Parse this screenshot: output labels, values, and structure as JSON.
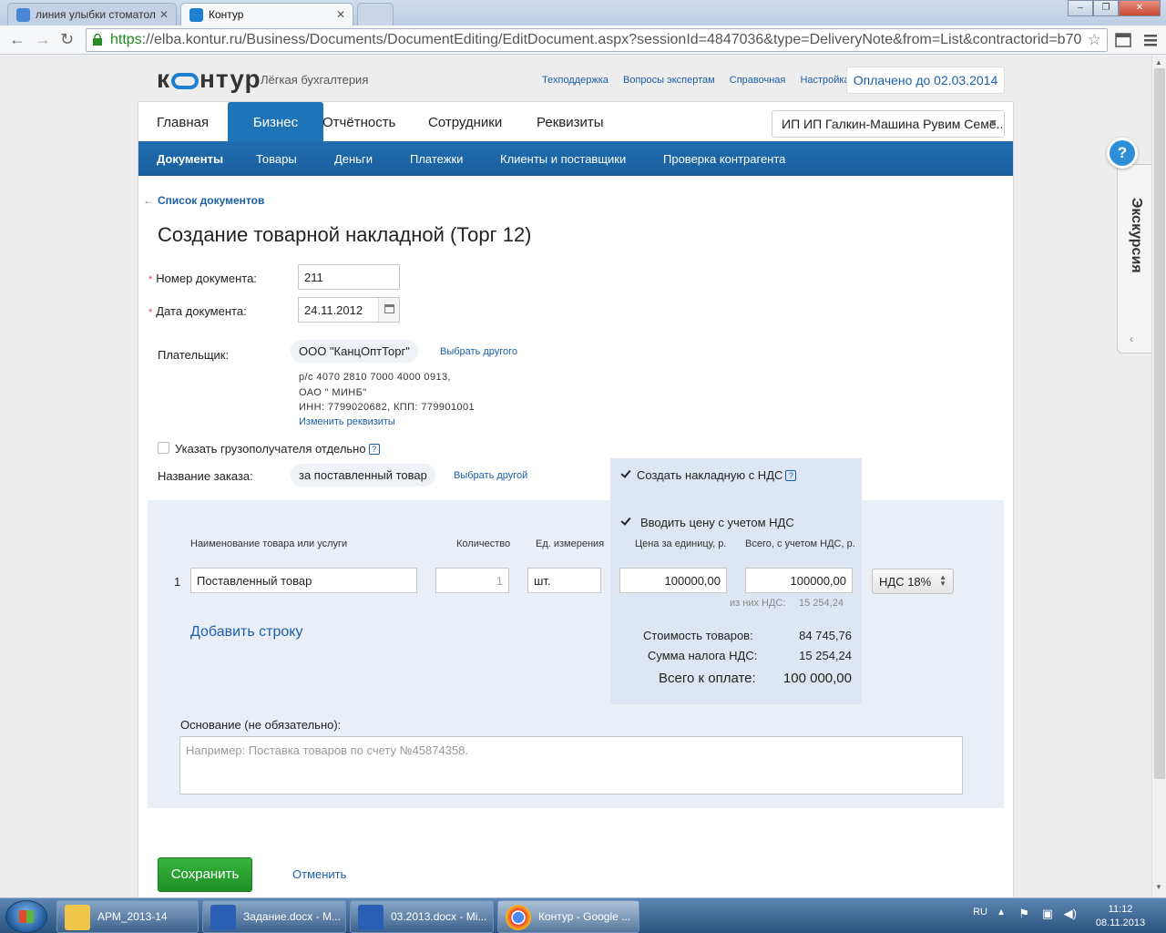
{
  "browser": {
    "tabs": [
      {
        "label": "линия улыбки стоматол",
        "favicon": "google-favicon"
      },
      {
        "label": "Контур",
        "favicon": "kontur-favicon"
      }
    ],
    "url_scheme": "https",
    "url_rest": "://elba.kontur.ru/Business/Documents/DocumentEditing/EditDocument.aspx?sessionId=4847036&type=DeliveryNote&from=List&contractorid=b70"
  },
  "header": {
    "logo_left": "к",
    "logo_right": "нтур",
    "tagline": "Лёгкая бухгалтерия",
    "links": [
      "Техподдержка",
      "Вопросы экспертам",
      "Справочная",
      "Настройка"
    ],
    "paid_until": "Оплачено до 02.03.2014"
  },
  "mainnav": {
    "items": [
      "Главная",
      "Бизнес",
      "Отчётность",
      "Сотрудники",
      "Реквизиты"
    ],
    "active": "Бизнес",
    "org": "ИП ИП Галкин-Машина Рувим Семе..."
  },
  "subnav": {
    "items": [
      "Документы",
      "Товары",
      "Деньги",
      "Платежки",
      "Клиенты и поставщики",
      "Проверка контрагента"
    ],
    "active": "Документы"
  },
  "form": {
    "back_link": "Список документов",
    "title": "Создание товарной накладной (Торг 12)",
    "doc_number_label": "Номер документа:",
    "doc_number": "211",
    "doc_date_label": "Дата документа:",
    "doc_date": "24.11.2012",
    "payer_label": "Плательщик:",
    "payer": "ООО \"КанцОптТорг\"",
    "choose_other": "Выбрать другого",
    "payer_details": [
      "р/с 4070 2810 7000 4000 0913,",
      "ОАО \" МИНБ\"",
      "ИНН: 7799020682, КПП: 779901001"
    ],
    "change_details": "Изменить реквизиты",
    "consignee_label": "Указать грузополучателя отдельно",
    "order_label": "Название заказа:",
    "order": "за поставленный товар",
    "order_choose": "Выбрать другой",
    "vat_invoice_label": "Создать накладную с НДС",
    "vat_price_label": "Вводить цену с учетом НДС",
    "basis_label": "Основание (не обязательно):",
    "basis_placeholder": "Например: Поставка товаров по счету №45874358.",
    "save": "Сохранить",
    "cancel": "Отменить"
  },
  "goods": {
    "headers": [
      "Наименование товара или услуги",
      "Количество",
      "Ед. измерения",
      "Цена за единицу, р.",
      "Всего, с учетом НДС, р."
    ],
    "rows": [
      {
        "n": "1",
        "name": "Поставленный товар",
        "qty": "1",
        "unit": "шт.",
        "price": "100000,00",
        "total": "100000,00",
        "vat": "НДС 18%",
        "vat_note_label": "из них НДС:",
        "vat_note_value": "15 254,24"
      }
    ],
    "add_row": "Добавить строку",
    "totals": [
      {
        "label": "Стоимость товаров:",
        "value": "84 745,76"
      },
      {
        "label": "Сумма налога НДС:",
        "value": "15 254,24"
      },
      {
        "label": "Всего к оплате:",
        "value": "100 000,00"
      }
    ]
  },
  "tour": {
    "label": "Экскурсия",
    "help": "?"
  },
  "taskbar": {
    "buttons": [
      "АРМ_2013-14",
      "Задание.docx - M...",
      "03.2013.docx - Mi...",
      "Контур - Google ..."
    ],
    "lang": "RU",
    "time": "11:12",
    "date": "08.11.2013"
  },
  "colors": {
    "accent": "#1f74b8",
    "link": "#1a5fa8",
    "save": "#2aa132"
  }
}
